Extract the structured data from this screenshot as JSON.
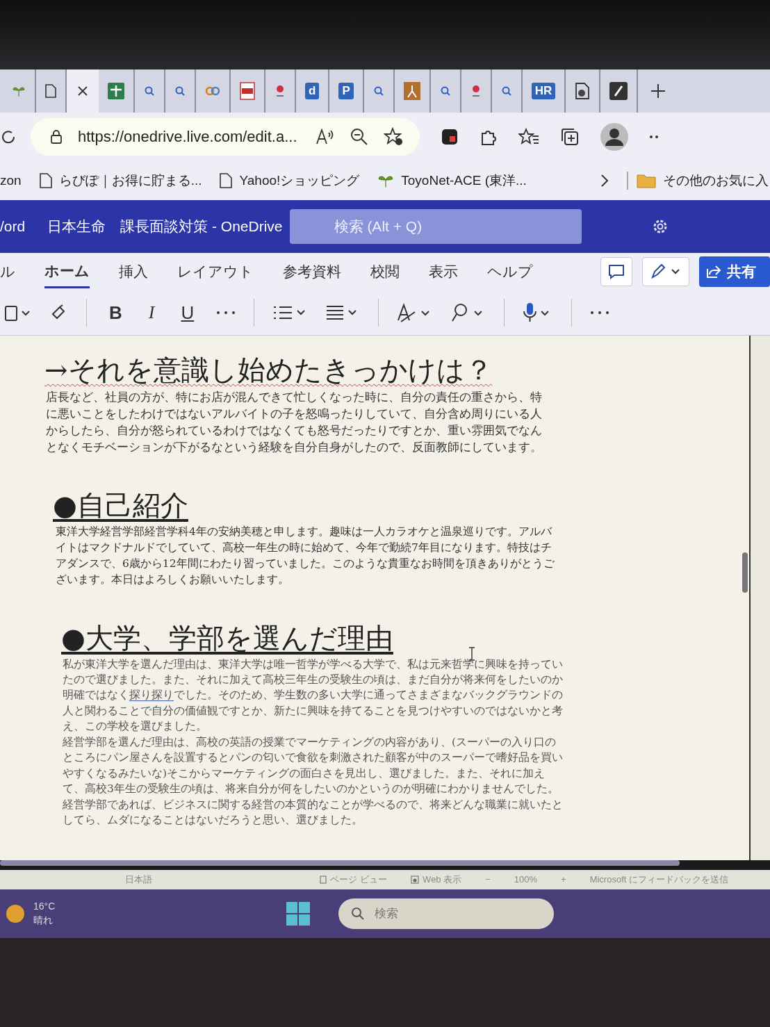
{
  "browser": {
    "tabs": [
      {
        "kind": "leaf",
        "selected": false
      },
      {
        "kind": "page",
        "selected": false
      },
      {
        "kind": "close",
        "selected": true
      },
      {
        "kind": "grid",
        "selected": false
      },
      {
        "kind": "search",
        "selected": false
      },
      {
        "kind": "search",
        "selected": false
      },
      {
        "kind": "co",
        "selected": false
      },
      {
        "kind": "pdf",
        "selected": false
      },
      {
        "kind": "pin",
        "selected": false
      },
      {
        "kind": "letter",
        "label": "d",
        "selected": false
      },
      {
        "kind": "letter",
        "label": "P",
        "selected": false
      },
      {
        "kind": "search",
        "selected": false
      },
      {
        "kind": "figure",
        "selected": false
      },
      {
        "kind": "search",
        "selected": false
      },
      {
        "kind": "pin",
        "selected": false
      },
      {
        "kind": "search",
        "selected": false
      },
      {
        "kind": "letter",
        "label": "HR",
        "selected": false
      },
      {
        "kind": "doc",
        "selected": false
      },
      {
        "kind": "app",
        "selected": false
      }
    ],
    "url": "https://onedrive.live.com/edit.a...",
    "bookmarks": [
      {
        "kind": "text",
        "label": "zon"
      },
      {
        "kind": "page",
        "label": "らびぽ｜お得に貯まる..."
      },
      {
        "kind": "page",
        "label": "Yahoo!ショッピング"
      },
      {
        "kind": "leaf",
        "label": "ToyoNet-ACE (東洋..."
      }
    ],
    "other_bookmarks": "その他のお気に入"
  },
  "word": {
    "app_name": "/ord",
    "title": "日本生命　課長面談対策 - OneDrive",
    "search_placeholder": "検索 (Alt + Q)",
    "ribbon_tabs": [
      {
        "label": "ル",
        "selected": false
      },
      {
        "label": "ホーム",
        "selected": true
      },
      {
        "label": "挿入",
        "selected": false
      },
      {
        "label": "レイアウト",
        "selected": false
      },
      {
        "label": "参考資料",
        "selected": false
      },
      {
        "label": "校閲",
        "selected": false
      },
      {
        "label": "表示",
        "selected": false
      },
      {
        "label": "ヘルプ",
        "selected": false
      }
    ],
    "share_label": "共有",
    "format_buttons": [
      "B",
      "I",
      "U"
    ]
  },
  "document": {
    "sections": [
      {
        "heading": "→それを意識し始めたきっかけは？",
        "underlined": false,
        "spelling_flag": true,
        "lines": [
          {
            "text": "店長など、社員の方が、特にお店が混んできて忙しくなった時に、自分の責任の重さから、特"
          },
          {
            "text": "に悪いことをしたわけではないアルバイトの子を怒鳴ったりしていて、自分含め周りにいる人"
          },
          {
            "text": "からしたら、自分が怒られているわけではなくても怒号だったりですとか、重い雰囲気でなん"
          },
          {
            "text": "となくモチベーションが下がるなという経験を自分自身がしたので、反面教師にしています。"
          }
        ]
      },
      {
        "heading": "●自己紹介",
        "underlined": true,
        "spelling_flag": false,
        "lines": [
          {
            "text": "東洋大学経営学部経営学科4年の安納美穂と申します。趣味は一人カラオケと温泉巡りです。アルバ"
          },
          {
            "text": "イトはマクドナルドでしていて、高校一年生の時に始めて、今年で勤続7年目になります。特技はチ"
          },
          {
            "text": "アダンスで、6歳から12年間にわたり習っていました。このような貴重なお時間を頂きありがとうご"
          },
          {
            "text": "ざいます。本日はよろしくお願いいたします。"
          }
        ]
      },
      {
        "heading": "●大学、学部を選んだ理由",
        "underlined": true,
        "spelling_flag": false,
        "lines": [
          {
            "text": "私が東洋大学を選んだ理由は、東洋大学は唯一哲学が学べる大学で、私は元来哲学に興味を持ってい"
          },
          {
            "text": "たので選びました。また、それに加えて高校三年生の受験生の頃は、まだ自分が将来何をしたいのか"
          },
          {
            "parts": [
              {
                "text": "明確ではなく",
                "flagged": false
              },
              {
                "text": "探り探り",
                "flagged": true
              },
              {
                "text": "でした。そのため、学生数の多い大学に通ってさまざまなバックグラウンドの",
                "flagged": false
              }
            ]
          },
          {
            "text": "人と関わることで自分の価値観ですとか、新たに興味を持てることを見つけやすいのではないかと考"
          },
          {
            "text": "え、この学校を選びました。"
          },
          {
            "text": "経営学部を選んだ理由は、高校の英語の授業でマーケティングの内容があり、(スーパーの入り口の"
          },
          {
            "text": "ところにパン屋さんを設置するとパンの匂いで食欲を刺激された顧客が中のスーパーで嗜好品を買い"
          },
          {
            "text": "やすくなるみたいな)そこからマーケティングの面白さを見出し、選びました。また、それに加え"
          },
          {
            "text": "て、高校3年生の受験生の頃は、将来自分が何をしたいのかというのが明確にわかりませんでした。"
          },
          {
            "text": "経営学部であれば、ビジネスに関する経営の本質的なことが学べるので、将来どんな職業に就いたと"
          },
          {
            "text": "してら、ムダになることはないだろうと思い、選びました。"
          }
        ]
      }
    ]
  },
  "status_bar": {
    "language": "日本語",
    "views": [
      {
        "label": "ページ ビュー",
        "kind": "page"
      },
      {
        "label": "Web 表示",
        "kind": "web"
      }
    ],
    "zoom_out": "−",
    "zoom": "100%",
    "zoom_in": "+",
    "feedback": "Microsoft にフィードバックを送信"
  },
  "taskbar": {
    "temperature": "16°C",
    "weather": "晴れ",
    "search_placeholder": "検索"
  }
}
